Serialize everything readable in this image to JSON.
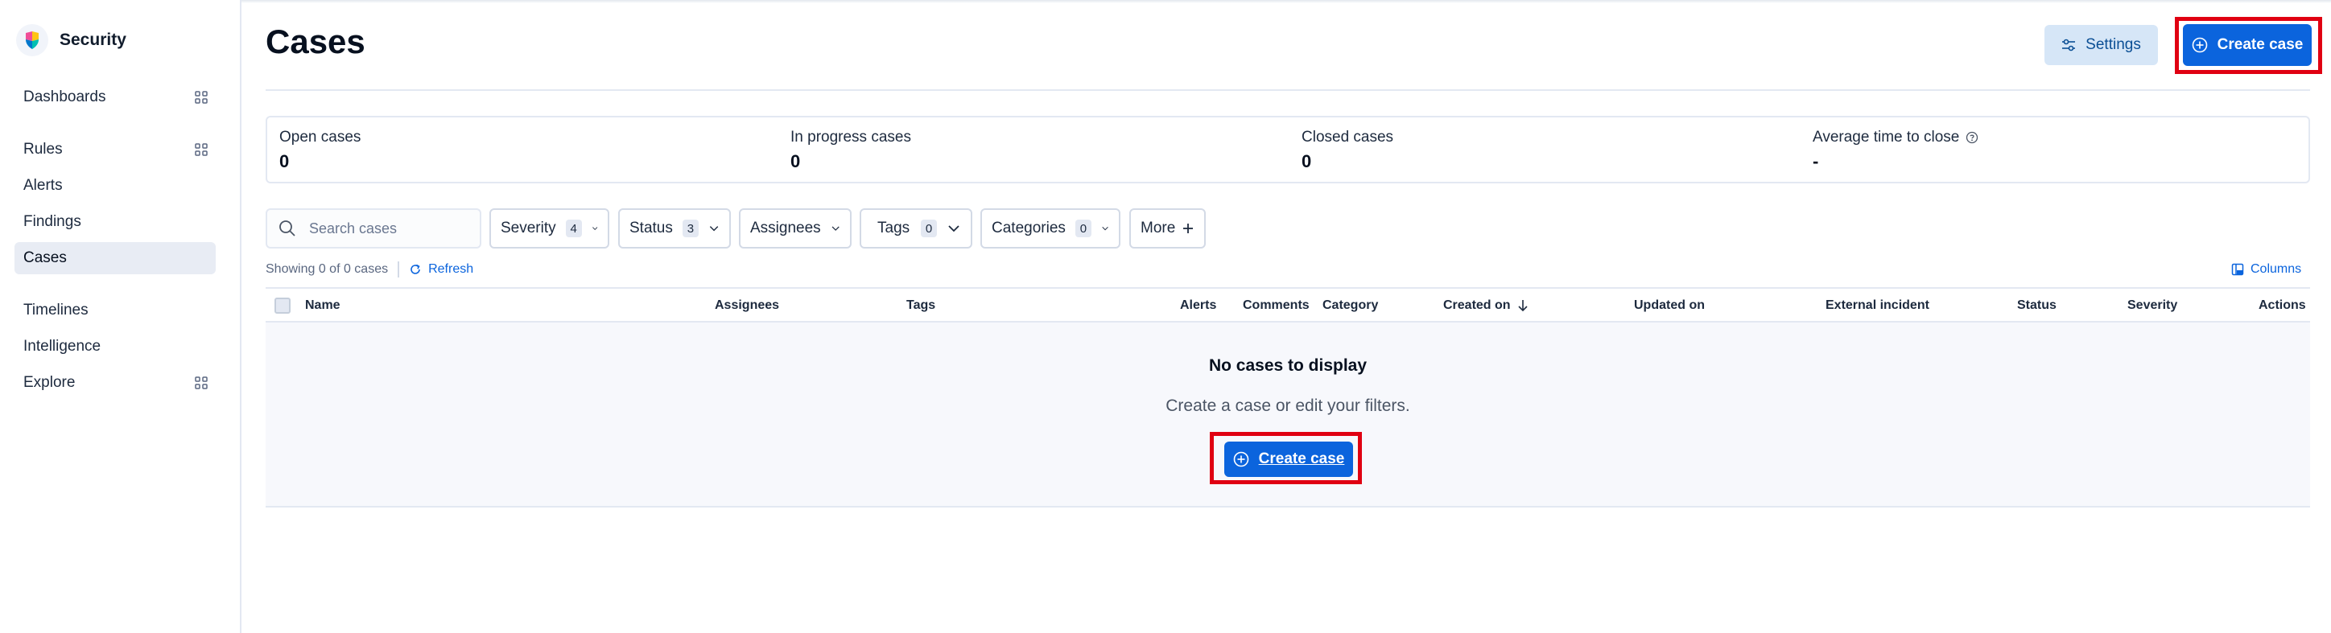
{
  "app": {
    "title": "Security"
  },
  "sidebar": {
    "items": [
      {
        "label": "Dashboards",
        "has_grid_icon": true
      },
      {
        "label": "Rules",
        "has_grid_icon": true
      },
      {
        "label": "Alerts"
      },
      {
        "label": "Findings"
      },
      {
        "label": "Cases",
        "active": true
      },
      {
        "label": "Timelines"
      },
      {
        "label": "Intelligence"
      },
      {
        "label": "Explore",
        "has_grid_icon": true
      }
    ]
  },
  "header": {
    "title": "Cases",
    "settings_label": "Settings",
    "create_label": "Create case"
  },
  "stats": [
    {
      "label": "Open cases",
      "value": "0"
    },
    {
      "label": "In progress cases",
      "value": "0"
    },
    {
      "label": "Closed cases",
      "value": "0"
    },
    {
      "label": "Average time to close",
      "value": "-"
    }
  ],
  "filters": {
    "search_placeholder": "Search cases",
    "severity": {
      "label": "Severity",
      "count": "4"
    },
    "status": {
      "label": "Status",
      "count": "3"
    },
    "assignees": {
      "label": "Assignees"
    },
    "tags": {
      "label": "Tags",
      "count": "0"
    },
    "categories": {
      "label": "Categories",
      "count": "0"
    },
    "more": {
      "label": "More"
    }
  },
  "results": {
    "showing": "Showing 0 of 0 cases",
    "refresh": "Refresh",
    "columns": "Columns"
  },
  "table": {
    "headers": {
      "name": "Name",
      "assignees": "Assignees",
      "tags": "Tags",
      "alerts": "Alerts",
      "comments": "Comments",
      "category": "Category",
      "created_on": "Created on",
      "updated_on": "Updated on",
      "external_incident": "External incident",
      "status": "Status",
      "severity": "Severity",
      "actions": "Actions"
    },
    "empty": {
      "title": "No cases to display",
      "subtitle": "Create a case or edit your filters.",
      "button": "Create case"
    }
  },
  "colors": {
    "primary": "#0b64dd",
    "highlight": "#e00012",
    "settings_bg": "#d6e6f7"
  }
}
